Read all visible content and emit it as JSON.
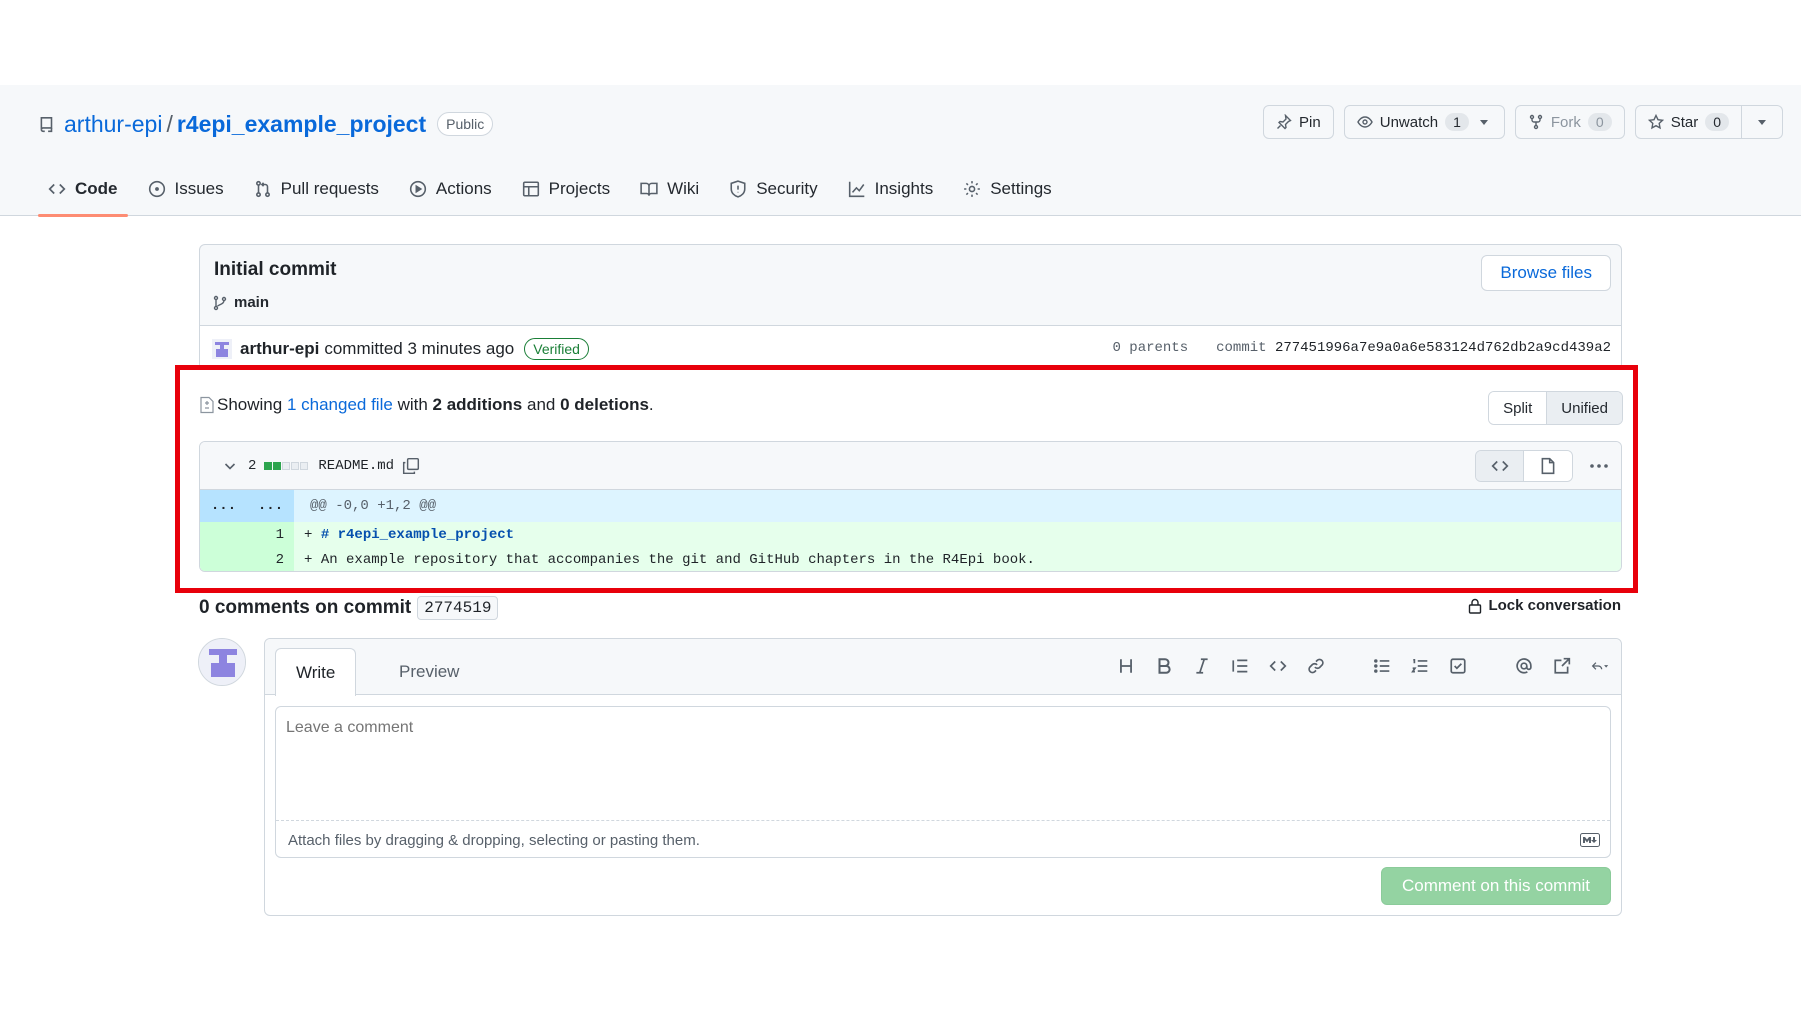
{
  "header": {
    "owner": "arthur-epi",
    "separator": "/",
    "repo": "r4epi_example_project",
    "visibility": "Public",
    "pin_label": "Pin",
    "unwatch_label": "Unwatch",
    "watch_count": "1",
    "fork_label": "Fork",
    "fork_count": "0",
    "star_label": "Star",
    "star_count": "0"
  },
  "tabs": [
    {
      "label": "Code",
      "icon": "code-icon"
    },
    {
      "label": "Issues",
      "icon": "issue-icon"
    },
    {
      "label": "Pull requests",
      "icon": "pull-request-icon"
    },
    {
      "label": "Actions",
      "icon": "play-icon"
    },
    {
      "label": "Projects",
      "icon": "table-icon"
    },
    {
      "label": "Wiki",
      "icon": "book-icon"
    },
    {
      "label": "Security",
      "icon": "shield-icon"
    },
    {
      "label": "Insights",
      "icon": "graph-icon"
    },
    {
      "label": "Settings",
      "icon": "gear-icon"
    }
  ],
  "commit": {
    "title": "Initial commit",
    "branch": "main",
    "browse_label": "Browse files",
    "author": "arthur-epi",
    "committed_text": "committed 3 minutes ago",
    "verified": "Verified",
    "parents": "0 parents",
    "commit_label": "commit",
    "sha": "277451996a7e9a0a6e583124d762db2a9cd439a2"
  },
  "summary": {
    "showing": "Showing",
    "changed": "1 changed file",
    "with": "with",
    "additions": "2 additions",
    "and": "and",
    "deletions": "0 deletions",
    "period": ".",
    "split_label": "Split",
    "unified_label": "Unified"
  },
  "diff": {
    "change_count": "2",
    "filename": "README.md",
    "hunk_left": "...",
    "hunk_right": "...",
    "hunk_header": "@@ -0,0 +1,2 @@",
    "lines": [
      {
        "num": "1",
        "prefix": "+ ",
        "text": "# r4epi_example_project"
      },
      {
        "num": "2",
        "prefix": "+ ",
        "text": "An example repository that accompanies the git and GitHub chapters in the R4Epi book."
      }
    ]
  },
  "comments": {
    "title": "0 comments on commit",
    "short_sha": "2774519",
    "lock_label": "Lock conversation",
    "write_tab": "Write",
    "preview_tab": "Preview",
    "placeholder": "Leave a comment",
    "attach_text": "Attach files by dragging & dropping, selecting or pasting them.",
    "submit_label": "Comment on this commit"
  },
  "colors": {
    "accent": "#0969da",
    "highlight": "#e8000b",
    "addition": "#e6ffec",
    "hunk": "#ddf4ff",
    "submit_disabled": "#94d3a2"
  }
}
